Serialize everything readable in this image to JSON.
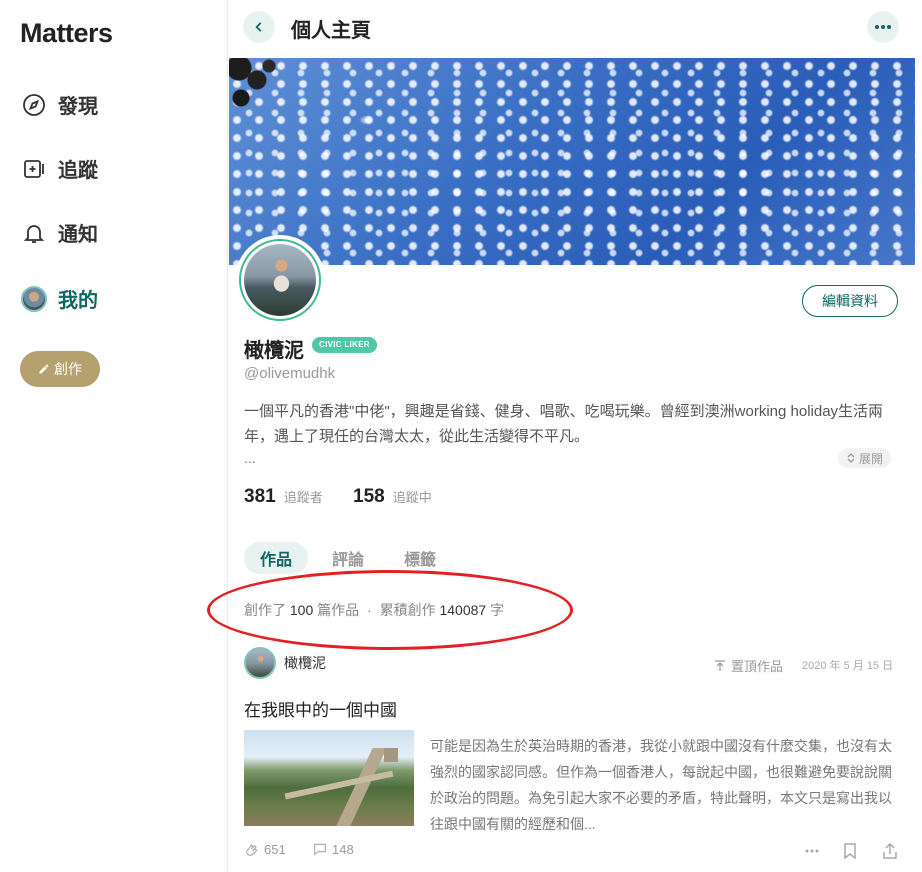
{
  "app": {
    "logo": "Matters"
  },
  "sidebar": {
    "items": [
      {
        "label": "發現",
        "icon": "compass-icon"
      },
      {
        "label": "追蹤",
        "icon": "follow-icon"
      },
      {
        "label": "通知",
        "icon": "bell-icon"
      },
      {
        "label": "我的",
        "icon": "avatar"
      }
    ],
    "create_label": "創作"
  },
  "header": {
    "title": "個人主頁"
  },
  "profile": {
    "name": "橄欖泥",
    "badge": "CIVIC LIKER",
    "handle": "@olivemudhk",
    "bio": "一個平凡的香港\"中佬\"，興趣是省錢、健身、唱歌、吃喝玩樂。曾經到澳洲working holiday生活兩年，遇上了現任的台灣太太，從此生活變得不平凡。",
    "bio_ellipsis": "...",
    "expand_label": "展開",
    "edit_label": "編輯資料",
    "followers_count": "381",
    "followers_label": "追蹤者",
    "following_count": "158",
    "following_label": "追蹤中"
  },
  "tabs": [
    {
      "label": "作品",
      "active": true
    },
    {
      "label": "評論",
      "active": false
    },
    {
      "label": "標籤",
      "active": false
    }
  ],
  "summary": {
    "prefix": "創作了",
    "count": "100",
    "mid": "篇作品",
    "sep": "·",
    "words_prefix": "累積創作",
    "words": "140087",
    "words_unit": "字"
  },
  "article": {
    "author": "橄欖泥",
    "pinned_label": "置頂作品",
    "date": "2020 年 5 月 15 日",
    "title": "在我眼中的一個中國",
    "summary": "可能是因為生於英治時期的香港，我從小就跟中國沒有什麼交集，也沒有太強烈的國家認同感。但作為一個香港人，每說起中國，也很難避免要說說關於政治的問題。為免引起大家不必要的矛盾，特此聲明，本文只是寫出我以往跟中國有關的經歷和個...",
    "appreciations": "651",
    "comments": "148"
  },
  "colors": {
    "accent": "#0d6763",
    "badge": "#4fc8a8",
    "create": "#b5a16e",
    "annotation": "#e32124"
  }
}
